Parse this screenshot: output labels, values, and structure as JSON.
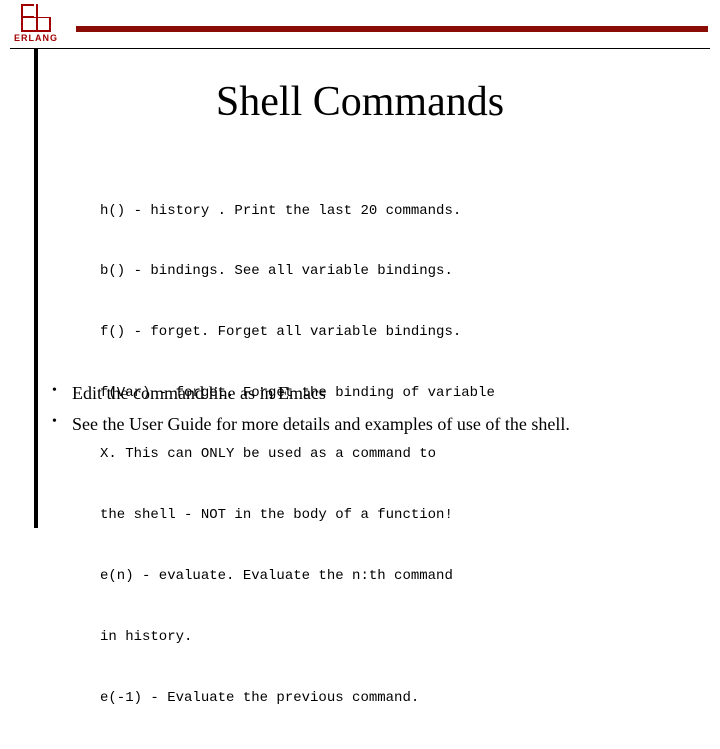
{
  "logo": {
    "text": "ERLANG"
  },
  "title": "Shell Commands",
  "code_lines": [
    "h() - history . Print the last 20 commands.",
    "b() - bindings. See all variable bindings.",
    "f() - forget. Forget all variable bindings.",
    "f(Var) - forget. Forget the binding of variable",
    "X. This can ONLY be used as a command to",
    "the shell - NOT in the body of a function!",
    "e(n) - evaluate. Evaluate the n:th command",
    "in history.",
    "e(-1) - Evaluate the previous command."
  ],
  "bullets": [
    "Edit the command line as in Emacs",
    "See the User Guide for more details and examples of use of the shell."
  ]
}
